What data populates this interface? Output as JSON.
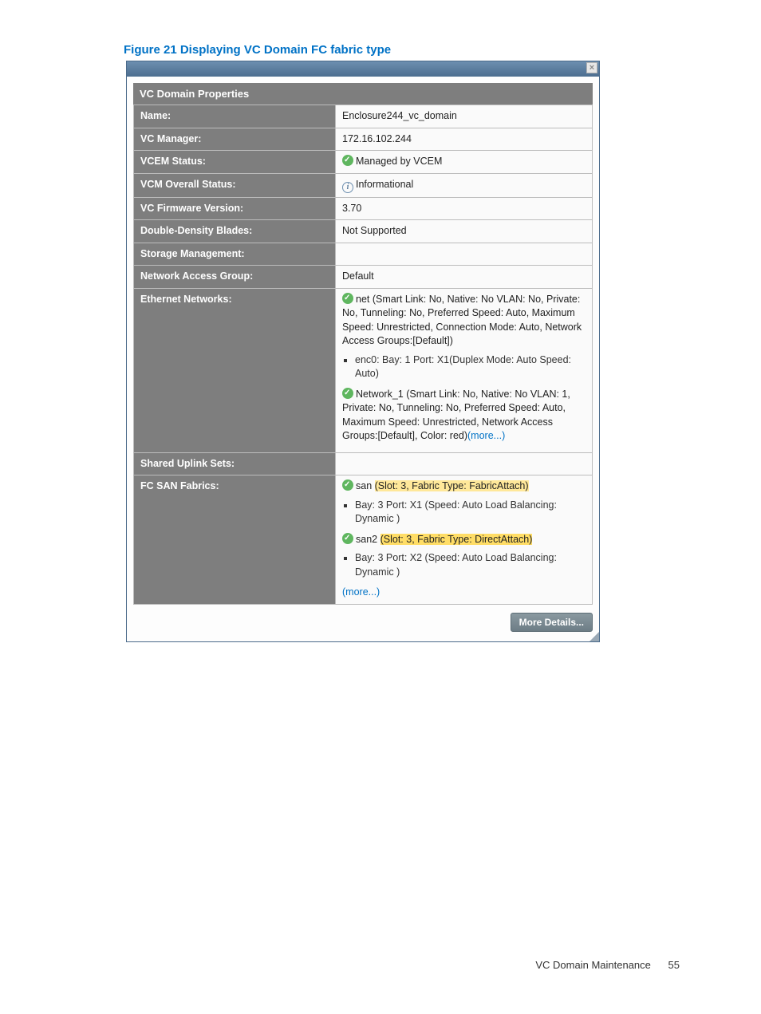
{
  "figure": {
    "caption": "Figure 21 Displaying VC Domain FC fabric type"
  },
  "dialog": {
    "close_glyph": "×",
    "title": "VC Domain Properties",
    "rows": {
      "name": {
        "label": "Name:",
        "value": "Enclosure244_vc_domain"
      },
      "vc_manager": {
        "label": "VC Manager:",
        "value": "172.16.102.244"
      },
      "vcem_status": {
        "label": "VCEM Status:",
        "value": "Managed by VCEM"
      },
      "vcm_overall": {
        "label": "VCM Overall Status:",
        "value": "Informational"
      },
      "fw_version": {
        "label": "VC Firmware Version:",
        "value": "3.70"
      },
      "dd_blades": {
        "label": "Double-Density Blades:",
        "value": "Not Supported"
      },
      "storage_mgmt": {
        "label": "Storage Management:",
        "value": ""
      },
      "nag": {
        "label": "Network Access Group:",
        "value": "Default"
      },
      "eth_networks": {
        "label": "Ethernet Networks:"
      },
      "shared_uplink": {
        "label": "Shared Uplink Sets:",
        "value": ""
      },
      "fc_san": {
        "label": "FC SAN Fabrics:"
      }
    },
    "ethernet": {
      "net1": {
        "text": "net (Smart Link: No, Native: No VLAN: No, Private: No, Tunneling: No, Preferred Speed: Auto, Maximum Speed: Unrestricted, Connection Mode: Auto, Network Access Groups:[Default])",
        "sub": "enc0: Bay: 1 Port: X1(Duplex Mode: Auto Speed: Auto)"
      },
      "net2": {
        "text": "Network_1 (Smart Link: No, Native: No VLAN: 1, Private: No, Tunneling: No, Preferred Speed: Auto, Maximum Speed: Unrestricted, Network Access Groups:[Default], Color: red)",
        "more": "(more...)"
      }
    },
    "fc": {
      "san1": {
        "name": "san",
        "paren": "(Slot: 3, Fabric Type: FabricAttach)",
        "sub": "Bay: 3 Port: X1 (Speed: Auto Load Balancing: Dynamic )"
      },
      "san2": {
        "name": "san2",
        "paren": "(Slot: 3, Fabric Type: DirectAttach)",
        "sub": "Bay: 3 Port: X2 (Speed: Auto Load Balancing: Dynamic )"
      },
      "more": "(more...)"
    },
    "more_details": "More Details..."
  },
  "footer": {
    "section": "VC Domain Maintenance",
    "page": "55"
  }
}
